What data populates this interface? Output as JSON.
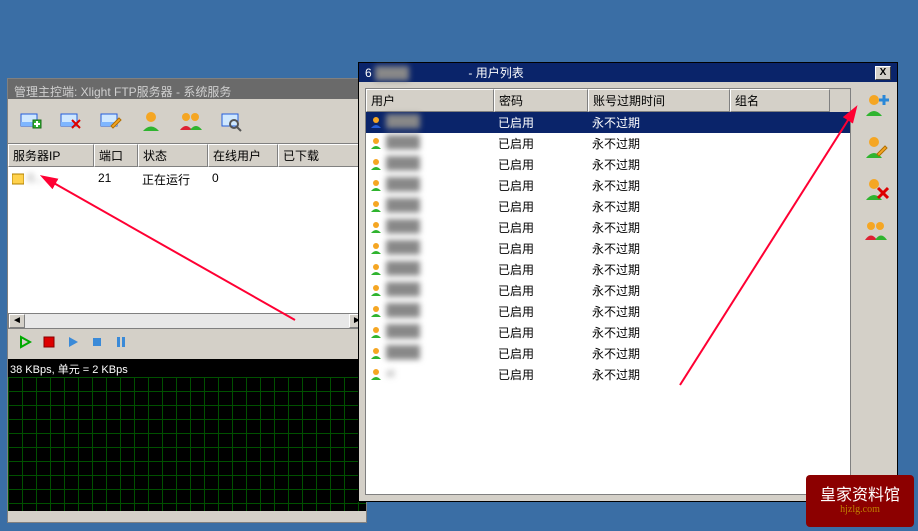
{
  "main_window": {
    "title": "管理主控端: Xlight FTP服务器 - 系统服务",
    "toolbar_icons": [
      "add-server",
      "remove-server",
      "edit-server",
      "user",
      "users",
      "search"
    ],
    "server_columns": [
      "服务器IP",
      "端口",
      "状态",
      "在线用户",
      "已下载"
    ],
    "server_row": {
      "ip_masked": "0...",
      "port": "21",
      "status": "正在运行",
      "online": "0",
      "downloaded": ""
    },
    "control_icons": [
      "start",
      "stop",
      "play",
      "skip",
      "pause"
    ],
    "chart_label": "38 KBps, 单元 = 2 KBps"
  },
  "chart_data": {
    "type": "line",
    "title": "",
    "xlabel": "",
    "ylabel": "KBps",
    "ylim": [
      0,
      38
    ],
    "unit_kbps": 2,
    "values": []
  },
  "user_window": {
    "title_prefix": "6",
    "title_suffix": "- 用户列表",
    "close": "X",
    "columns": [
      "用户",
      "密码",
      "账号过期时间",
      "组名"
    ],
    "rows": [
      {
        "user_masked": "",
        "pwd": "已启用",
        "exp": "永不过期",
        "grp": "",
        "selected": true,
        "color": "blue"
      },
      {
        "user_masked": "",
        "pwd": "已启用",
        "exp": "永不过期",
        "grp": "",
        "selected": false,
        "color": "green"
      },
      {
        "user_masked": "",
        "pwd": "已启用",
        "exp": "永不过期",
        "grp": "",
        "selected": false,
        "color": "green"
      },
      {
        "user_masked": "",
        "pwd": "已启用",
        "exp": "永不过期",
        "grp": "",
        "selected": false,
        "color": "green"
      },
      {
        "user_masked": "",
        "pwd": "已启用",
        "exp": "永不过期",
        "grp": "",
        "selected": false,
        "color": "green"
      },
      {
        "user_masked": "",
        "pwd": "已启用",
        "exp": "永不过期",
        "grp": "",
        "selected": false,
        "color": "green"
      },
      {
        "user_masked": "",
        "pwd": "已启用",
        "exp": "永不过期",
        "grp": "",
        "selected": false,
        "color": "green"
      },
      {
        "user_masked": "",
        "pwd": "已启用",
        "exp": "永不过期",
        "grp": "",
        "selected": false,
        "color": "green"
      },
      {
        "user_masked": "",
        "pwd": "已启用",
        "exp": "永不过期",
        "grp": "",
        "selected": false,
        "color": "green"
      },
      {
        "user_masked": "",
        "pwd": "已启用",
        "exp": "永不过期",
        "grp": "",
        "selected": false,
        "color": "green"
      },
      {
        "user_masked": "",
        "pwd": "已启用",
        "exp": "永不过期",
        "grp": "",
        "selected": false,
        "color": "green"
      },
      {
        "user_masked": "",
        "pwd": "已启用",
        "exp": "永不过期",
        "grp": "",
        "selected": false,
        "color": "green"
      },
      {
        "user_masked": "xi",
        "pwd": "已启用",
        "exp": "永不过期",
        "grp": "",
        "selected": false,
        "color": "green"
      }
    ],
    "side_icons": [
      "add-user",
      "edit-user",
      "delete-user",
      "user-groups"
    ]
  },
  "watermark": {
    "text": "皇家资料馆",
    "url": "hjzlg.com"
  },
  "colors": {
    "desktop": "#3a6ea5",
    "selection": "#0a246a",
    "titlebar": "#0a246a",
    "inactive_titlebar": "#6a6a6a",
    "annotation": "#ff0033"
  }
}
